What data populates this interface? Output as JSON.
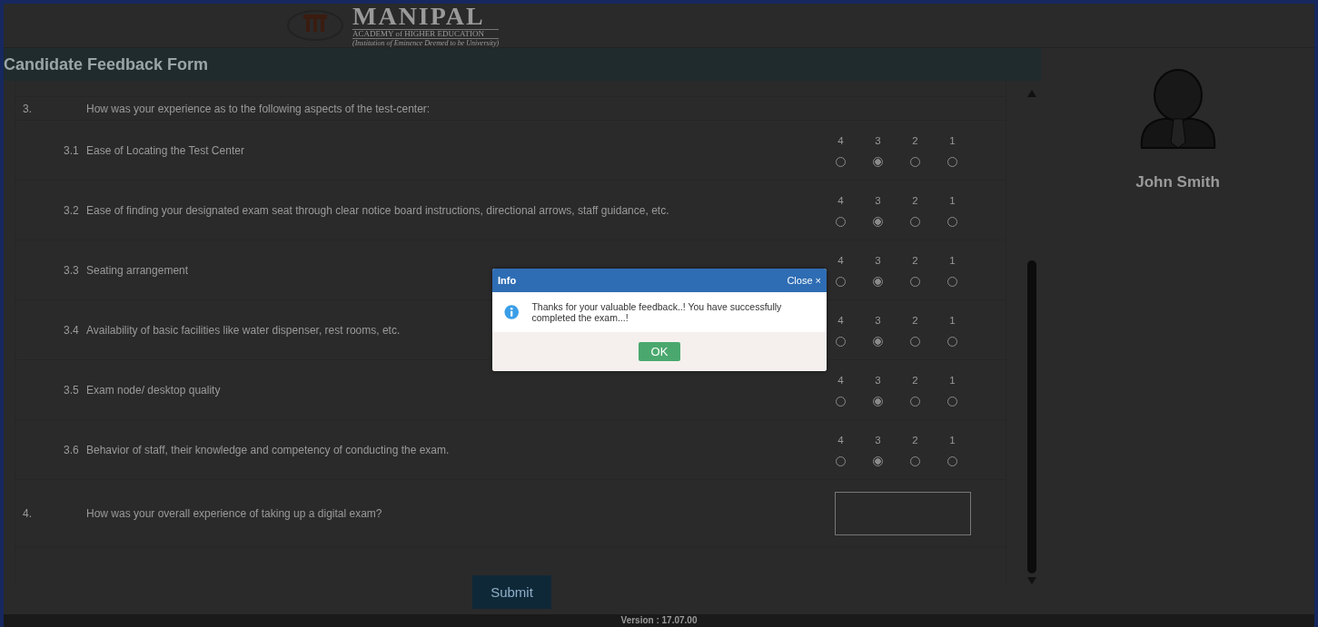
{
  "header": {
    "logo": {
      "name": "MANIPAL",
      "subtitle": "ACADEMY of HIGHER EDUCATION",
      "tagline": "(Institution of Eminence Deemed to be University)"
    }
  },
  "form": {
    "title": "Candidate Feedback Form",
    "questions": [
      {
        "kind": "heading",
        "number": "3.",
        "text": "How was your experience as to the following aspects of the test-center:"
      },
      {
        "kind": "rating",
        "number": "3.1",
        "text": "Ease of Locating the Test Center",
        "options": [
          {
            "label": "4",
            "selected": false
          },
          {
            "label": "3",
            "selected": true
          },
          {
            "label": "2",
            "selected": false
          },
          {
            "label": "1",
            "selected": false
          }
        ]
      },
      {
        "kind": "rating",
        "number": "3.2",
        "text": "Ease of finding your designated exam seat through clear notice board instructions, directional arrows, staff guidance, etc.",
        "options": [
          {
            "label": "4",
            "selected": false
          },
          {
            "label": "3",
            "selected": true
          },
          {
            "label": "2",
            "selected": false
          },
          {
            "label": "1",
            "selected": false
          }
        ]
      },
      {
        "kind": "rating",
        "number": "3.3",
        "text": "Seating arrangement",
        "options": [
          {
            "label": "4",
            "selected": false
          },
          {
            "label": "3",
            "selected": true
          },
          {
            "label": "2",
            "selected": false
          },
          {
            "label": "1",
            "selected": false
          }
        ]
      },
      {
        "kind": "rating",
        "number": "3.4",
        "text": "Availability of basic facilities like water dispenser, rest rooms, etc.",
        "options": [
          {
            "label": "4",
            "selected": false
          },
          {
            "label": "3",
            "selected": true
          },
          {
            "label": "2",
            "selected": false
          },
          {
            "label": "1",
            "selected": false
          }
        ]
      },
      {
        "kind": "rating",
        "number": "3.5",
        "text": "Exam node/ desktop quality",
        "options": [
          {
            "label": "4",
            "selected": false
          },
          {
            "label": "3",
            "selected": true
          },
          {
            "label": "2",
            "selected": false
          },
          {
            "label": "1",
            "selected": false
          }
        ]
      },
      {
        "kind": "rating",
        "number": "3.6",
        "text": "Behavior of staff, their knowledge and competency of conducting the exam.",
        "options": [
          {
            "label": "4",
            "selected": false
          },
          {
            "label": "3",
            "selected": true
          },
          {
            "label": "2",
            "selected": false
          },
          {
            "label": "1",
            "selected": false
          }
        ]
      },
      {
        "kind": "text",
        "number": "4.",
        "text": "How was your overall experience of taking up a digital exam?"
      }
    ],
    "submit": "Submit"
  },
  "profile": {
    "name": "John Smith"
  },
  "footer": {
    "version": "Version : 17.07.00"
  },
  "dialog": {
    "title": "Info",
    "close": "Close",
    "close_glyph": "×",
    "message": "Thanks for your valuable feedback..! You have successfully completed the exam...!",
    "ok": "OK"
  }
}
